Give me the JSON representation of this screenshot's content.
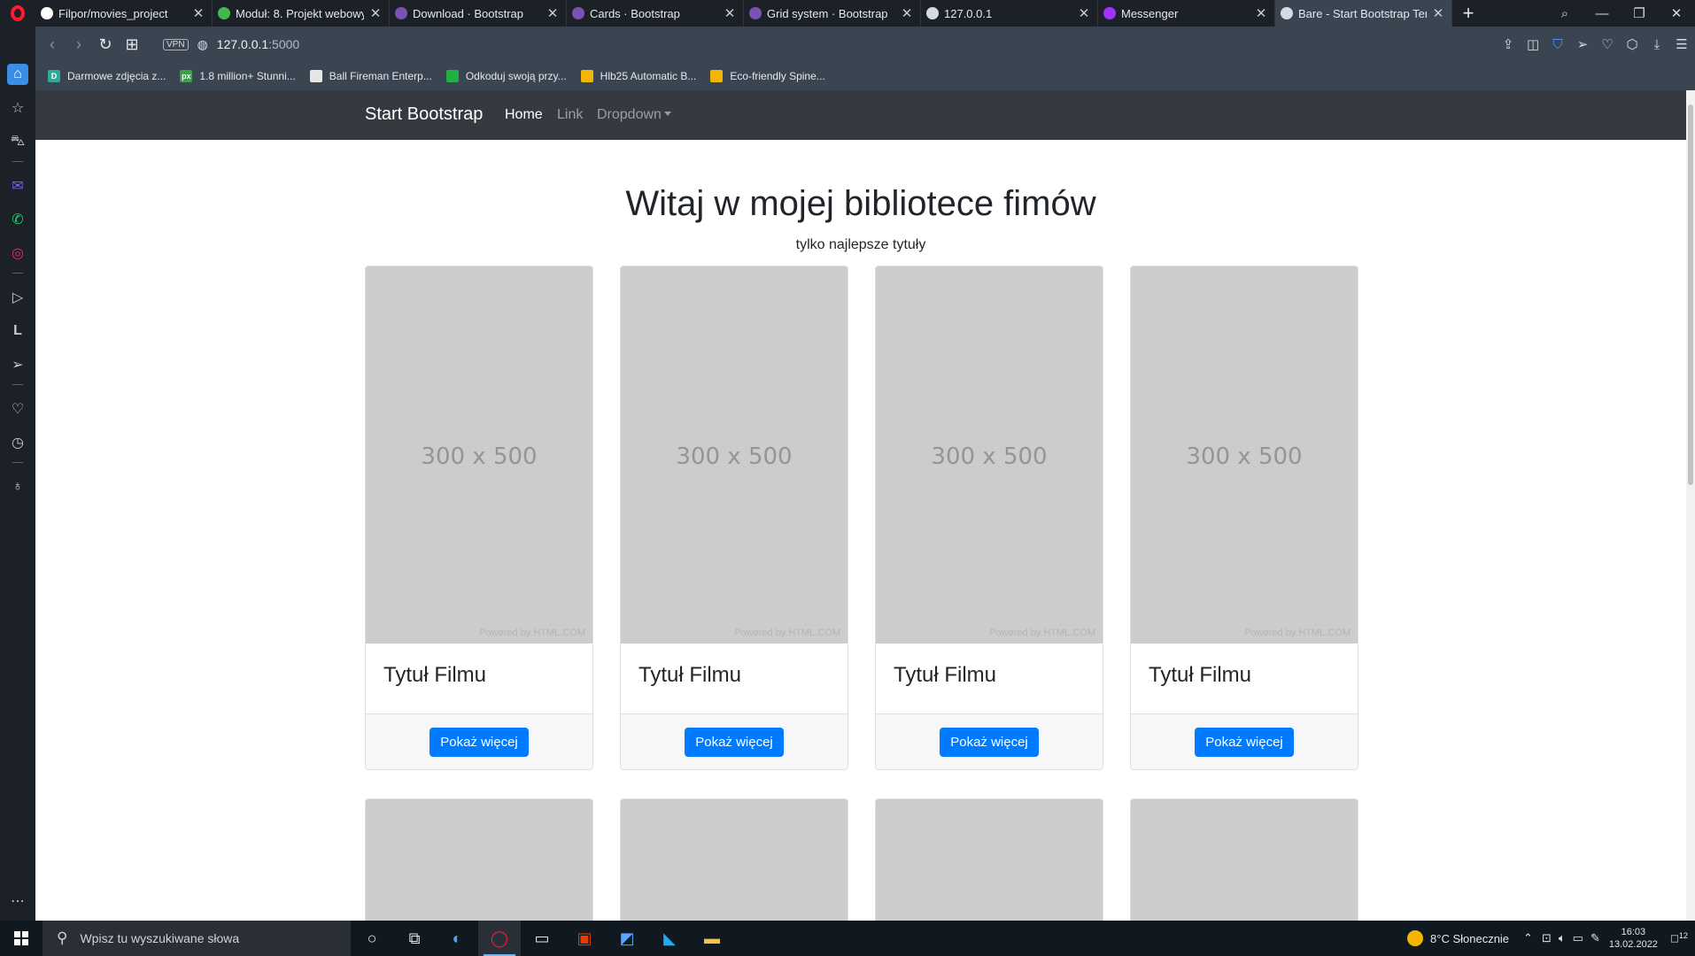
{
  "browser": {
    "tabs": [
      {
        "title": "Filpor/movies_project",
        "favicon": "github-icon",
        "color": "#ffffff",
        "active": false
      },
      {
        "title": "Moduł: 8. Projekt webowy",
        "favicon": "green-circle-icon",
        "color": "#3fb950",
        "active": false
      },
      {
        "title": "Download · Bootstrap",
        "favicon": "bootstrap-icon",
        "color": "#7952b3",
        "active": false
      },
      {
        "title": "Cards · Bootstrap",
        "favicon": "bootstrap-icon",
        "color": "#7952b3",
        "active": false
      },
      {
        "title": "Grid system · Bootstrap",
        "favicon": "bootstrap-icon",
        "color": "#7952b3",
        "active": false
      },
      {
        "title": "127.0.0.1",
        "favicon": "globe-icon",
        "color": "#d7dae0",
        "active": false
      },
      {
        "title": "Messenger",
        "favicon": "messenger-icon",
        "color": "#a033ff",
        "active": false
      },
      {
        "title": "Bare - Start Bootstrap Temp",
        "favicon": "globe-icon",
        "color": "#d7dae0",
        "active": true
      }
    ],
    "url": {
      "host": "127.0.0.1",
      "port": ":5000"
    },
    "vpn_label": "VPN",
    "bookmarks": [
      {
        "label": "Darmowe zdjęcia z...",
        "icon": "D",
        "color": "#2fa89a"
      },
      {
        "label": "1.8 million+ Stunni...",
        "icon": "px",
        "color": "#3aa14a"
      },
      {
        "label": "Ball Fireman Enterp...",
        "icon": "",
        "color": "#e6e6e6"
      },
      {
        "label": "Odkoduj swoją przy...",
        "icon": "",
        "color": "#1fb141"
      },
      {
        "label": "Hlb25 Automatic B...",
        "icon": "",
        "color": "#f2b705"
      },
      {
        "label": "Eco-friendly Spine...",
        "icon": "",
        "color": "#f2b705"
      }
    ]
  },
  "page": {
    "brand": "Start Bootstrap",
    "nav": {
      "home": "Home",
      "link": "Link",
      "dropdown": "Dropdown"
    },
    "heading": "Witaj w mojej bibliotece fimów",
    "subheading": "tylko najlepsze tytuły",
    "cards": [
      {
        "placeholder": "300 x 500",
        "powered": "Powered by HTML.COM",
        "title": "Tytuł Filmu",
        "button": "Pokaż więcej"
      },
      {
        "placeholder": "300 x 500",
        "powered": "Powered by HTML.COM",
        "title": "Tytuł Filmu",
        "button": "Pokaż więcej"
      },
      {
        "placeholder": "300 x 500",
        "powered": "Powered by HTML.COM",
        "title": "Tytuł Filmu",
        "button": "Pokaż więcej"
      },
      {
        "placeholder": "300 x 500",
        "powered": "Powered by HTML.COM",
        "title": "Tytuł Filmu",
        "button": "Pokaż więcej"
      }
    ],
    "accent": "#007bff"
  },
  "taskbar": {
    "search_placeholder": "Wpisz tu wyszukiwane słowa",
    "weather": "8°C  Słonecznie",
    "time": "16:03",
    "date": "13.02.2022",
    "notifications": "12"
  }
}
